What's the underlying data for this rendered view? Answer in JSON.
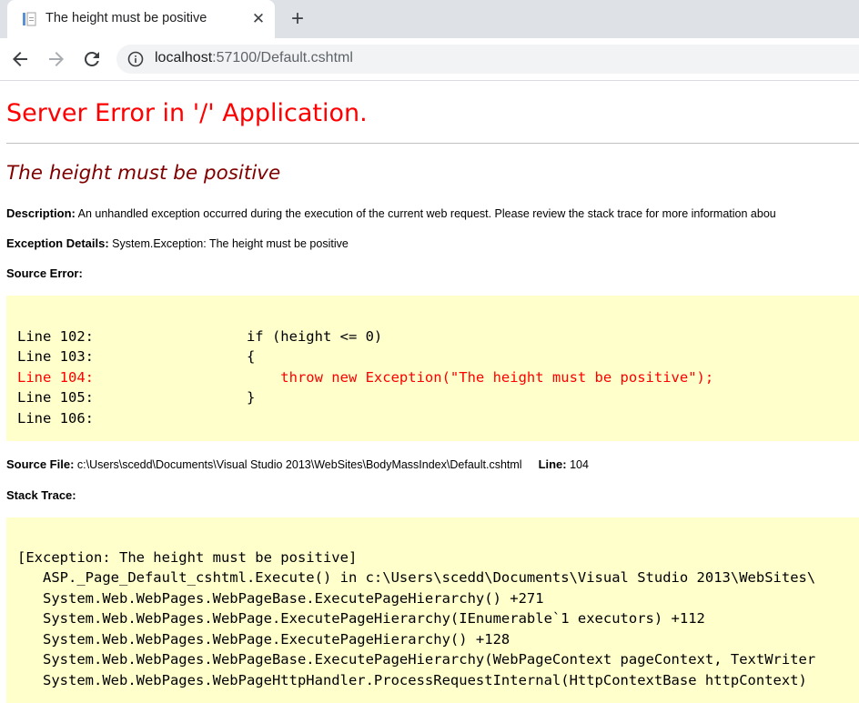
{
  "browser": {
    "tab_title": "The height must be positive",
    "tab_close": "✕",
    "new_tab": "+",
    "url_host": "localhost",
    "url_path": ":57100/Default.cshtml"
  },
  "page": {
    "heading": "Server Error in '/' Application.",
    "error_title": "The height must be positive",
    "description_label": "Description:",
    "description_text": " An unhandled exception occurred during the execution of the current web request. Please review the stack trace for more information abou",
    "exception_label": "Exception Details:",
    "exception_text": " System.Exception: The height must be positive",
    "source_error_label": "Source Error:",
    "source_lines": [
      "Line 102:                  if (height <= 0)",
      "Line 103:                  {",
      "Line 104:                      throw new Exception(\"The height must be positive\");",
      "Line 105:                  }",
      "Line 106:"
    ],
    "source_file_label": "Source File:",
    "source_file_text": " c:\\Users\\scedd\\Documents\\Visual Studio 2013\\WebSites\\BodyMassIndex\\Default.cshtml",
    "line_label": "Line:",
    "line_value": " 104",
    "stack_trace_label": "Stack Trace:",
    "stack_lines": [
      "[Exception: The height must be positive]",
      "   ASP._Page_Default_cshtml.Execute() in c:\\Users\\scedd\\Documents\\Visual Studio 2013\\WebSites\\",
      "   System.Web.WebPages.WebPageBase.ExecutePageHierarchy() +271",
      "   System.Web.WebPages.WebPage.ExecutePageHierarchy(IEnumerable`1 executors) +112",
      "   System.Web.WebPages.WebPage.ExecutePageHierarchy() +128",
      "   System.Web.WebPages.WebPageBase.ExecutePageHierarchy(WebPageContext pageContext, TextWriter",
      "   System.Web.WebPages.WebPageHttpHandler.ProcessRequestInternal(HttpContextBase httpContext)"
    ]
  },
  "colors": {
    "heading": "#ff0000",
    "error_title": "#800000",
    "code_bg": "#ffffcc",
    "error_line": "#ff0000"
  }
}
